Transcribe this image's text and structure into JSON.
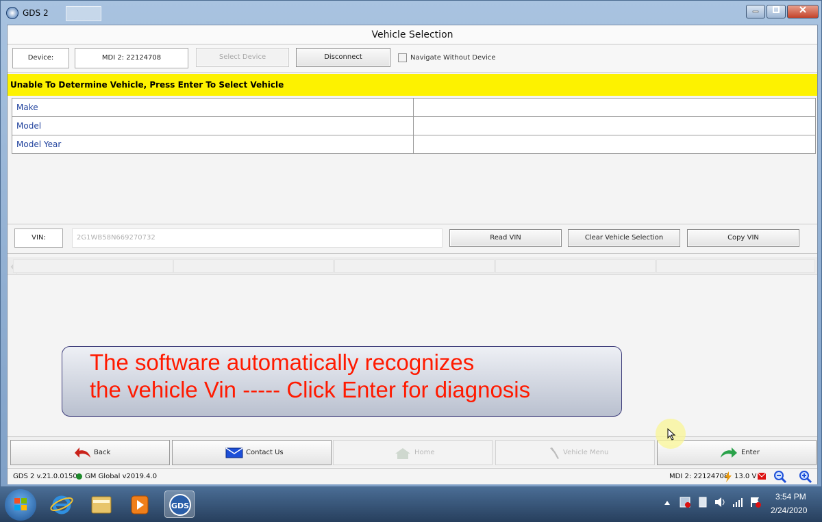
{
  "window": {
    "title": "GDS 2",
    "controls": [
      "minimize",
      "maximize",
      "close"
    ]
  },
  "header": {
    "title": "Vehicle Selection"
  },
  "device_bar": {
    "device_label": "Device:",
    "device_value": "MDI 2: 22124708",
    "select_device": "Select Device",
    "disconnect": "Disconnect",
    "navigate_without_device": "Navigate Without Device",
    "navigate_checked": false
  },
  "banner": {
    "text": "Unable To Determine Vehicle, Press Enter To Select Vehicle",
    "color": "#fdf200"
  },
  "vehicle_fields": [
    {
      "label": "Make",
      "value": ""
    },
    {
      "label": "Model",
      "value": ""
    },
    {
      "label": "Model Year",
      "value": ""
    }
  ],
  "vin_panel": {
    "vin_label": "VIN:",
    "vin_value": "2G1WB58N669270732",
    "read_vin": "Read VIN",
    "clear_selection": "Clear Vehicle Selection",
    "copy_vin": "Copy VIN"
  },
  "callout": {
    "line1": "The software automatically recognizes",
    "line2": "the vehicle Vin ----- Click Enter for diagnosis",
    "text_color": "#ff1a00"
  },
  "bottom_nav": {
    "back": "Back",
    "contact_us": "Contact Us",
    "home": "Home",
    "vehicle_menu": "Vehicle Menu",
    "enter": "Enter"
  },
  "status": {
    "version": "GDS 2 v.21.0.01501",
    "global": "GM Global v2019.4.0",
    "mdi": "MDI 2: 22124708",
    "voltage": "13.0 V"
  },
  "taskbar": {
    "time": "3:54 PM",
    "date": "2/24/2020",
    "pinned": [
      "windows-start",
      "internet-explorer",
      "file-explorer",
      "media-player",
      "gds-app"
    ]
  }
}
